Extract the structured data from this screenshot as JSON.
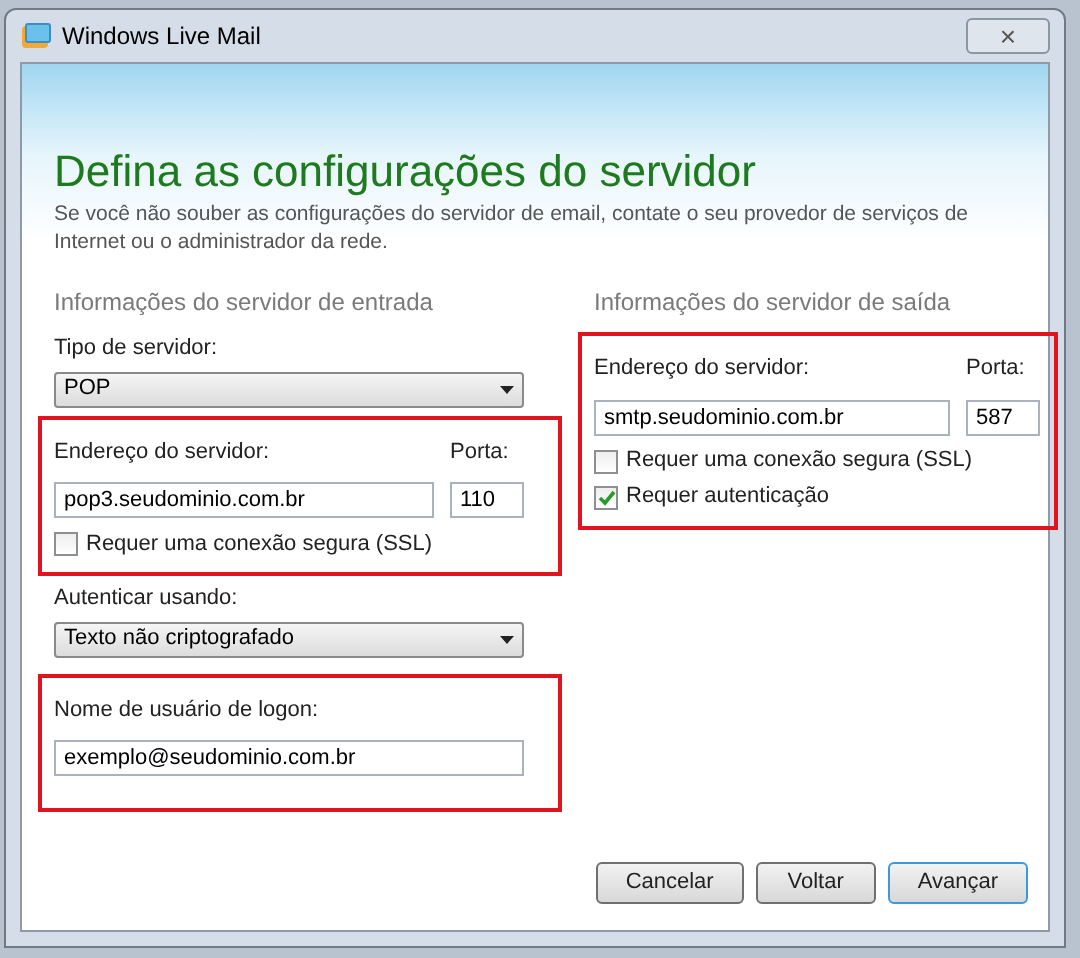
{
  "window": {
    "title": "Windows Live Mail",
    "close": "×"
  },
  "heading": "Defina as configurações do servidor",
  "description": "Se você não souber as configurações do servidor de email, contate o seu provedor de serviços de Internet ou o administrador da rede.",
  "incoming": {
    "title": "Informações do servidor de entrada",
    "server_type": {
      "label": "Tipo de servidor:",
      "value": "POP"
    },
    "address": {
      "highlighted": true,
      "label": "Endereço do servidor:",
      "value": "pop3.seudominio.com.br",
      "port_label": "Porta:",
      "port": "110",
      "options": [
        {
          "label": "Requer uma conexão segura (SSL)",
          "checked": false
        }
      ]
    },
    "auth": {
      "label": "Autenticar usando:",
      "value": "Texto não criptografado"
    },
    "logon": {
      "highlighted": true,
      "label": "Nome de usuário de logon:",
      "value": "exemplo@seudominio.com.br"
    }
  },
  "outgoing": {
    "title": "Informações do servidor de saída",
    "address": {
      "highlighted": true,
      "label": "Endereço do servidor:",
      "value": "smtp.seudominio.com.br",
      "port_label": "Porta:",
      "port": "587",
      "options": [
        {
          "label": "Requer uma conexão segura (SSL)",
          "checked": false
        },
        {
          "label": "Requer autenticação",
          "checked": true
        }
      ]
    }
  },
  "buttons": [
    {
      "label": "Cancelar",
      "default": false
    },
    {
      "label": "Voltar",
      "default": false
    },
    {
      "label": "Avançar",
      "default": true
    }
  ]
}
